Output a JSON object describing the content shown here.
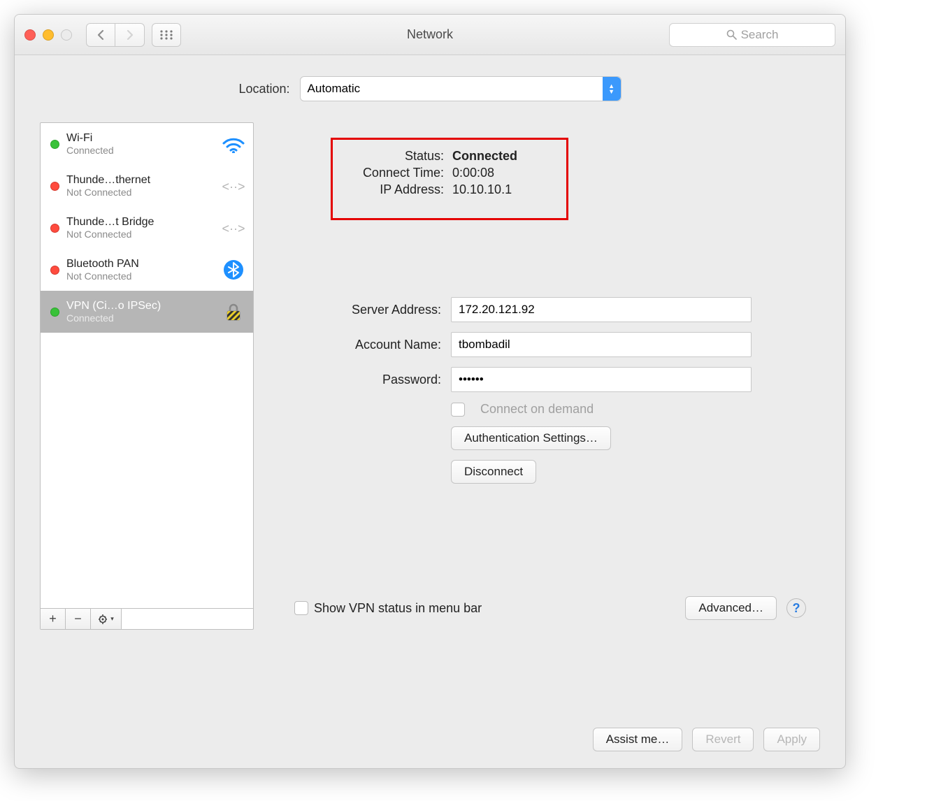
{
  "window": {
    "title": "Network",
    "search_placeholder": "Search"
  },
  "location": {
    "label": "Location:",
    "value": "Automatic"
  },
  "sidebar": {
    "items": [
      {
        "name": "Wi-Fi",
        "status": "Connected",
        "dot": "green",
        "icon": "wifi"
      },
      {
        "name": "Thunde…thernet",
        "status": "Not Connected",
        "dot": "red",
        "icon": "ethernet"
      },
      {
        "name": "Thunde…t Bridge",
        "status": "Not Connected",
        "dot": "red",
        "icon": "ethernet"
      },
      {
        "name": "Bluetooth PAN",
        "status": "Not Connected",
        "dot": "red",
        "icon": "bluetooth"
      },
      {
        "name": "VPN (Ci…o IPSec)",
        "status": "Connected",
        "dot": "green",
        "icon": "lock"
      }
    ],
    "selected_index": 4
  },
  "detail": {
    "status_label": "Status:",
    "status_value": "Connected",
    "connect_time_label": "Connect Time:",
    "connect_time_value": "0:00:08",
    "ip_label": "IP Address:",
    "ip_value": "10.10.10.1",
    "server_label": "Server Address:",
    "server_value": "172.20.121.92",
    "account_label": "Account Name:",
    "account_value": "tbombadil",
    "password_label": "Password:",
    "password_value": "••••••",
    "connect_on_demand": "Connect on demand",
    "auth_settings": "Authentication Settings…",
    "disconnect": "Disconnect",
    "show_status_menu": "Show VPN status in menu bar",
    "advanced": "Advanced…"
  },
  "footer": {
    "assist": "Assist me…",
    "revert": "Revert",
    "apply": "Apply"
  }
}
